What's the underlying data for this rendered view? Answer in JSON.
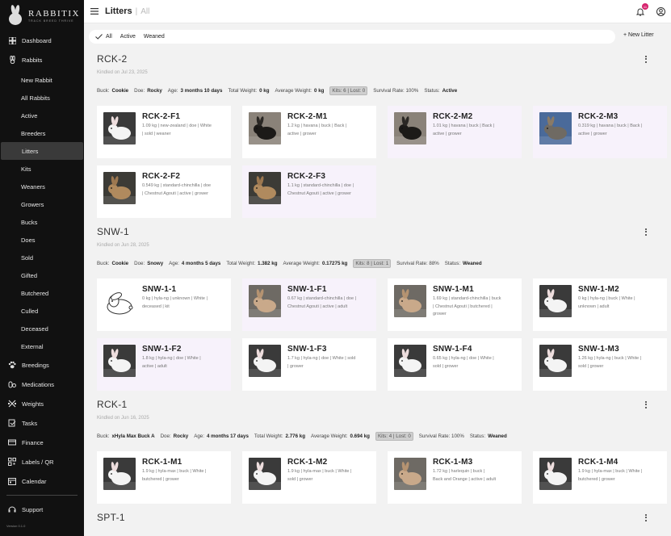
{
  "app": {
    "brand": "RABBITIX",
    "tagline": "TRACK BREED THRIVE",
    "version": "Version 0.1.0"
  },
  "sidebar": {
    "items": [
      {
        "label": "Dashboard",
        "icon": "dashboard-icon"
      },
      {
        "label": "Rabbits",
        "icon": "rabbit-icon"
      }
    ],
    "sub_items": [
      {
        "label": "New Rabbit"
      },
      {
        "label": "All Rabbits"
      },
      {
        "label": "Active"
      },
      {
        "label": "Breeders"
      },
      {
        "label": "Litters",
        "active": true
      },
      {
        "label": "Kits"
      },
      {
        "label": "Weaners"
      },
      {
        "label": "Growers"
      },
      {
        "label": "Bucks"
      },
      {
        "label": "Does"
      },
      {
        "label": "Sold"
      },
      {
        "label": "Gifted"
      },
      {
        "label": "Butchered"
      },
      {
        "label": "Culled"
      },
      {
        "label": "Deceased"
      },
      {
        "label": "External"
      }
    ],
    "bottom_items": [
      {
        "label": "Breedings",
        "icon": "paw-icon"
      },
      {
        "label": "Medications",
        "icon": "medication-icon"
      },
      {
        "label": "Weights",
        "icon": "weight-icon"
      },
      {
        "label": "Tasks",
        "icon": "tasks-icon"
      },
      {
        "label": "Finance",
        "icon": "finance-icon"
      },
      {
        "label": "Labels / QR",
        "icon": "qr-icon"
      },
      {
        "label": "Calendar",
        "icon": "calendar-icon"
      }
    ],
    "support": {
      "label": "Support",
      "icon": "support-icon"
    }
  },
  "topbar": {
    "title": "Litters",
    "breadcrumb": "All",
    "notification_count": "11"
  },
  "filters": {
    "all": "All",
    "active": "Active",
    "weaned": "Weaned",
    "new_litter": "+ New Litter"
  },
  "labels": {
    "buck": "Buck:",
    "doe": "Doe:",
    "age": "Age:",
    "total_weight": "Total Weight:",
    "average_weight": "Average Weight:",
    "survival_rate": "Survival Rate:",
    "status": "Status:"
  },
  "litters": [
    {
      "name": "RCK-2",
      "kindled": "Kindled on Jul 23, 2025",
      "buck": "Cookie",
      "doe": "Rocky",
      "age": "3 months 10 days",
      "total_weight": "0 kg",
      "average_weight": "0 kg",
      "kits": "Kits: 6 | Lost: 0",
      "survival_rate": "Survival Rate: 100%",
      "status": "Active",
      "kits_list": [
        {
          "name": "RCK-2-F1",
          "desc1": "1.09 kg | new-zealand | doe | White",
          "desc2": "| sold | weaner",
          "desc3": "",
          "thumb": "white-rabbit",
          "bg": "white"
        },
        {
          "name": "RCK-2-M1",
          "desc1": "1.2 kg | havana | buck | Back |",
          "desc2": "active | grower",
          "desc3": "",
          "thumb": "black-rabbit",
          "bg": "white"
        },
        {
          "name": "RCK-2-M2",
          "desc1": "1.01 kg | havana | buck | Back |",
          "desc2": "active | grower",
          "desc3": "",
          "thumb": "black-rabbit",
          "bg": "pink"
        },
        {
          "name": "RCK-2-M3",
          "desc1": "0.319 kg | havana | buck | Back |",
          "desc2": "active | grower",
          "desc3": "",
          "thumb": "blue-rabbit",
          "bg": "pink"
        },
        {
          "name": "RCK-2-F2",
          "desc1": "0.549 kg | standard-chinchilla | doe",
          "desc2": "| Chestnut Agouti | active | grower",
          "desc3": "",
          "thumb": "brown-rabbit",
          "bg": "white"
        },
        {
          "name": "RCK-2-F3",
          "desc1": "1.1 kg | standard-chinchilla | doe |",
          "desc2": "Chestnut Agouti | active | grower",
          "desc3": "",
          "thumb": "brown-rabbit",
          "bg": "pink"
        }
      ]
    },
    {
      "name": "SNW-1",
      "kindled": "Kindled on Jun 28, 2025",
      "buck": "Cookie",
      "doe": "Snowy",
      "age": "4 months 5 days",
      "total_weight": "1.382 kg",
      "average_weight": "0.17275 kg",
      "kits": "Kits: 8 | Lost: 1",
      "survival_rate": "Survival Rate: 88%",
      "status": "Weaned",
      "kits_list": [
        {
          "name": "SNW-1-1",
          "desc1": "0 kg | hyla-ng | unknown | White |",
          "desc2": "deceased | kit",
          "desc3": "",
          "thumb": "cartoon-rabbit",
          "bg": "white"
        },
        {
          "name": "SNW-1-F1",
          "desc1": "0.67 kg | standard-chinchilla | doe |",
          "desc2": "Chestnut Agouti | active | adult",
          "desc3": "",
          "thumb": "tan-rabbit",
          "bg": "pink"
        },
        {
          "name": "SNW-1-M1",
          "desc1": "1.69 kg | standard-chinchilla | buck",
          "desc2": "| Chestnut Agouti | butchered |",
          "desc3": "grower",
          "thumb": "tan-rabbit",
          "bg": "white"
        },
        {
          "name": "SNW-1-M2",
          "desc1": "0 kg | hyla-ng | buck | White |",
          "desc2": "unknown | adult",
          "desc3": "",
          "thumb": "white-rabbit",
          "bg": "white"
        },
        {
          "name": "SNW-1-F2",
          "desc1": "1.8 kg | hyla-ng | doe | White |",
          "desc2": "active | adult",
          "desc3": "",
          "thumb": "white-rabbit",
          "bg": "pink"
        },
        {
          "name": "SNW-1-F3",
          "desc1": "1.7 kg | hyla-ng | doe | White | sold",
          "desc2": "| grower",
          "desc3": "",
          "thumb": "white-rabbit",
          "bg": "white"
        },
        {
          "name": "SNW-1-F4",
          "desc1": "0.65 kg | hyla-ng | doe | White |",
          "desc2": "sold | grower",
          "desc3": "",
          "thumb": "white-rabbit",
          "bg": "white"
        },
        {
          "name": "SNW-1-M3",
          "desc1": "1.26 kg | hyla-ng | buck | White |",
          "desc2": "sold | grower",
          "desc3": "",
          "thumb": "white-rabbit",
          "bg": "white"
        }
      ]
    },
    {
      "name": "RCK-1",
      "kindled": "Kindled on Jun 16, 2025",
      "buck": "xHyla Max Buck A",
      "doe": "Rocky",
      "age": "4 months 17 days",
      "total_weight": "2.776 kg",
      "average_weight": "0.694 kg",
      "kits": "Kits: 4 | Lost: 0",
      "survival_rate": "Survival Rate: 100%",
      "status": "Weaned",
      "kits_list": [
        {
          "name": "RCK-1-M1",
          "desc1": "1.9 kg | hyla-max | buck | White |",
          "desc2": "butchered | grower",
          "desc3": "",
          "thumb": "white-rabbit",
          "bg": "white"
        },
        {
          "name": "RCK-1-M2",
          "desc1": "1.9 kg | hyla-max | buck | White |",
          "desc2": "sold | grower",
          "desc3": "",
          "thumb": "white-rabbit",
          "bg": "white"
        },
        {
          "name": "RCK-1-M3",
          "desc1": "1.72 kg | harlequin | buck |",
          "desc2": "Back and Orange | active | adult",
          "desc3": "",
          "thumb": "tan-rabbit",
          "bg": "white"
        },
        {
          "name": "RCK-1-M4",
          "desc1": "1.9 kg | hyla-max | buck | White |",
          "desc2": "butchered | grower",
          "desc3": "",
          "thumb": "white-rabbit",
          "bg": "white"
        }
      ]
    },
    {
      "name": "SPT-1"
    }
  ],
  "colors": {
    "sidebar_bg": "#111111",
    "active_item": "#3a3a3a",
    "badge": "#d6246e",
    "card_pink": "#f7f2fb"
  }
}
